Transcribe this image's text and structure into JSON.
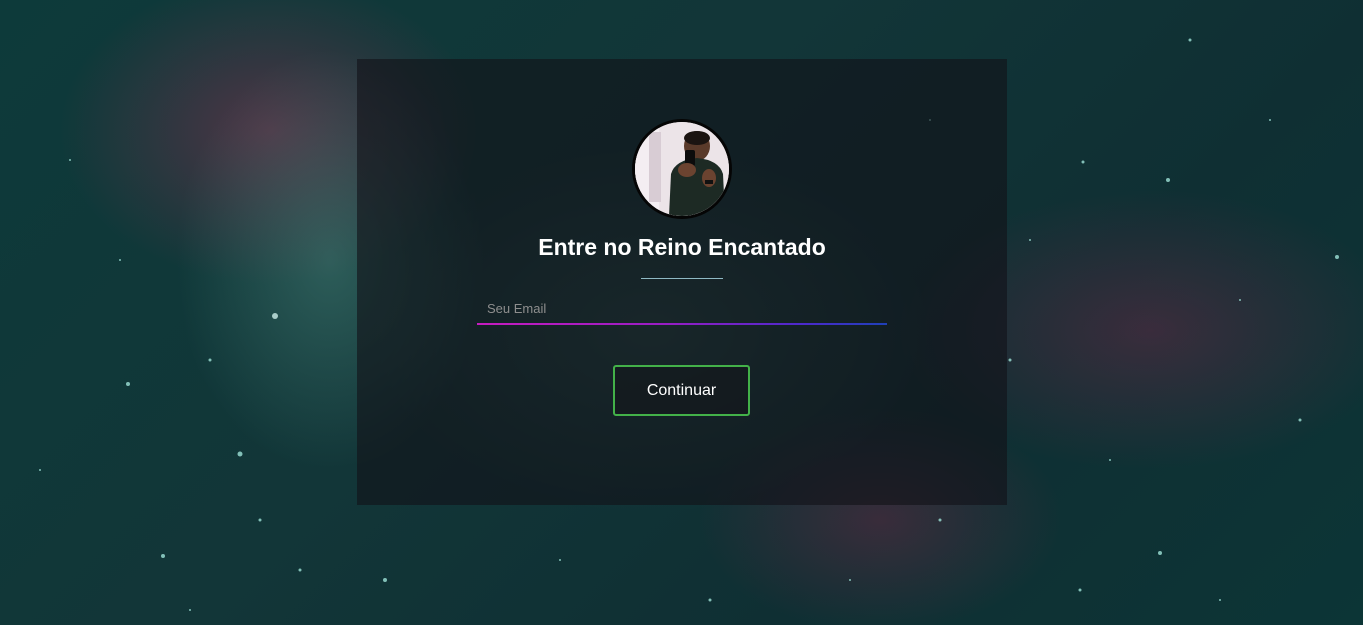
{
  "login": {
    "title": "Entre no Reino Encantado",
    "email_placeholder": "Seu Email",
    "email_value": "",
    "submit_label": "Continuar"
  },
  "colors": {
    "button_border": "#43b149",
    "underline_start": "#c61cc0",
    "underline_end": "#1f40b8",
    "card_overlay": "rgba(18,18,24,0.62)"
  },
  "icons": {
    "avatar": "profile-photo"
  }
}
